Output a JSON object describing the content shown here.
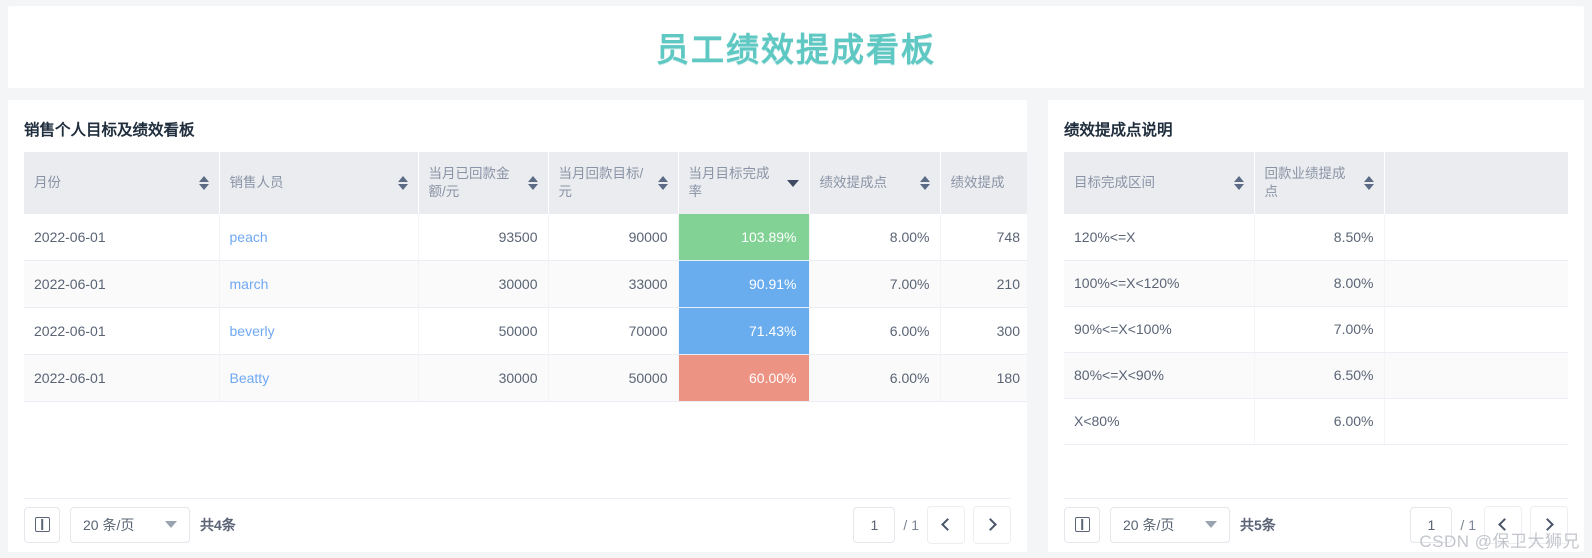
{
  "header": {
    "title": "员工绩效提成看板",
    "accent_color": "#5fc8c3"
  },
  "left_panel": {
    "title": "销售个人目标及绩效看板",
    "columns": [
      {
        "label": "月份",
        "sort": "both"
      },
      {
        "label": "销售人员",
        "sort": "both"
      },
      {
        "label": "当月已回款金额/元",
        "sort": "both"
      },
      {
        "label": "当月回款目标/元",
        "sort": "both"
      },
      {
        "label": "当月目标完成率",
        "sort": "desc"
      },
      {
        "label": "绩效提成点",
        "sort": "both"
      },
      {
        "label": "绩效提成",
        "sort": "none"
      }
    ],
    "rows": [
      {
        "month": "2022-06-01",
        "person": "peach",
        "received": "93500",
        "target": "90000",
        "rate": "103.89%",
        "rate_color": "green",
        "point": "8.00%",
        "commission": "748"
      },
      {
        "month": "2022-06-01",
        "person": "march",
        "received": "30000",
        "target": "33000",
        "rate": "90.91%",
        "rate_color": "blue",
        "point": "7.00%",
        "commission": "210"
      },
      {
        "month": "2022-06-01",
        "person": "beverly",
        "received": "50000",
        "target": "70000",
        "rate": "71.43%",
        "rate_color": "blue",
        "point": "6.00%",
        "commission": "300"
      },
      {
        "month": "2022-06-01",
        "person": "Beatty",
        "received": "30000",
        "target": "50000",
        "rate": "60.00%",
        "rate_color": "salmon",
        "point": "6.00%",
        "commission": "180"
      }
    ],
    "pager": {
      "columns_icon": "columns-settings-icon",
      "page_size": "20 条/页",
      "total": "共4条",
      "current_page": "1",
      "page_of": "/ 1",
      "prev_icon": "chevron-left-icon",
      "next_icon": "chevron-right-icon"
    }
  },
  "right_panel": {
    "title": "绩效提成点说明",
    "columns": [
      {
        "label": "目标完成区间",
        "sort": "both"
      },
      {
        "label": "回款业绩提成点",
        "sort": "both"
      },
      {
        "label": "",
        "sort": "none"
      }
    ],
    "rows": [
      {
        "range": "120%<=X",
        "point": "8.50%",
        "extra": ""
      },
      {
        "range": "100%<=X<120%",
        "point": "8.00%",
        "extra": ""
      },
      {
        "range": "90%<=X<100%",
        "point": "7.00%",
        "extra": ""
      },
      {
        "range": "80%<=X<90%",
        "point": "6.50%",
        "extra": ""
      },
      {
        "range": "X<80%",
        "point": "6.00%",
        "extra": ""
      }
    ],
    "pager": {
      "columns_icon": "columns-settings-icon",
      "page_size": "20 条/页",
      "total": "共5条",
      "current_page": "1",
      "page_of": "/ 1",
      "prev_icon": "chevron-left-icon",
      "next_icon": "chevron-right-icon"
    }
  },
  "watermark": "CSDN @保卫大狮兄",
  "colors": {
    "rate_green": "#82d295",
    "rate_blue": "#6aadee",
    "rate_salmon": "#ed9384",
    "link": "#6fa8f5",
    "header_bg": "#eaecef"
  }
}
